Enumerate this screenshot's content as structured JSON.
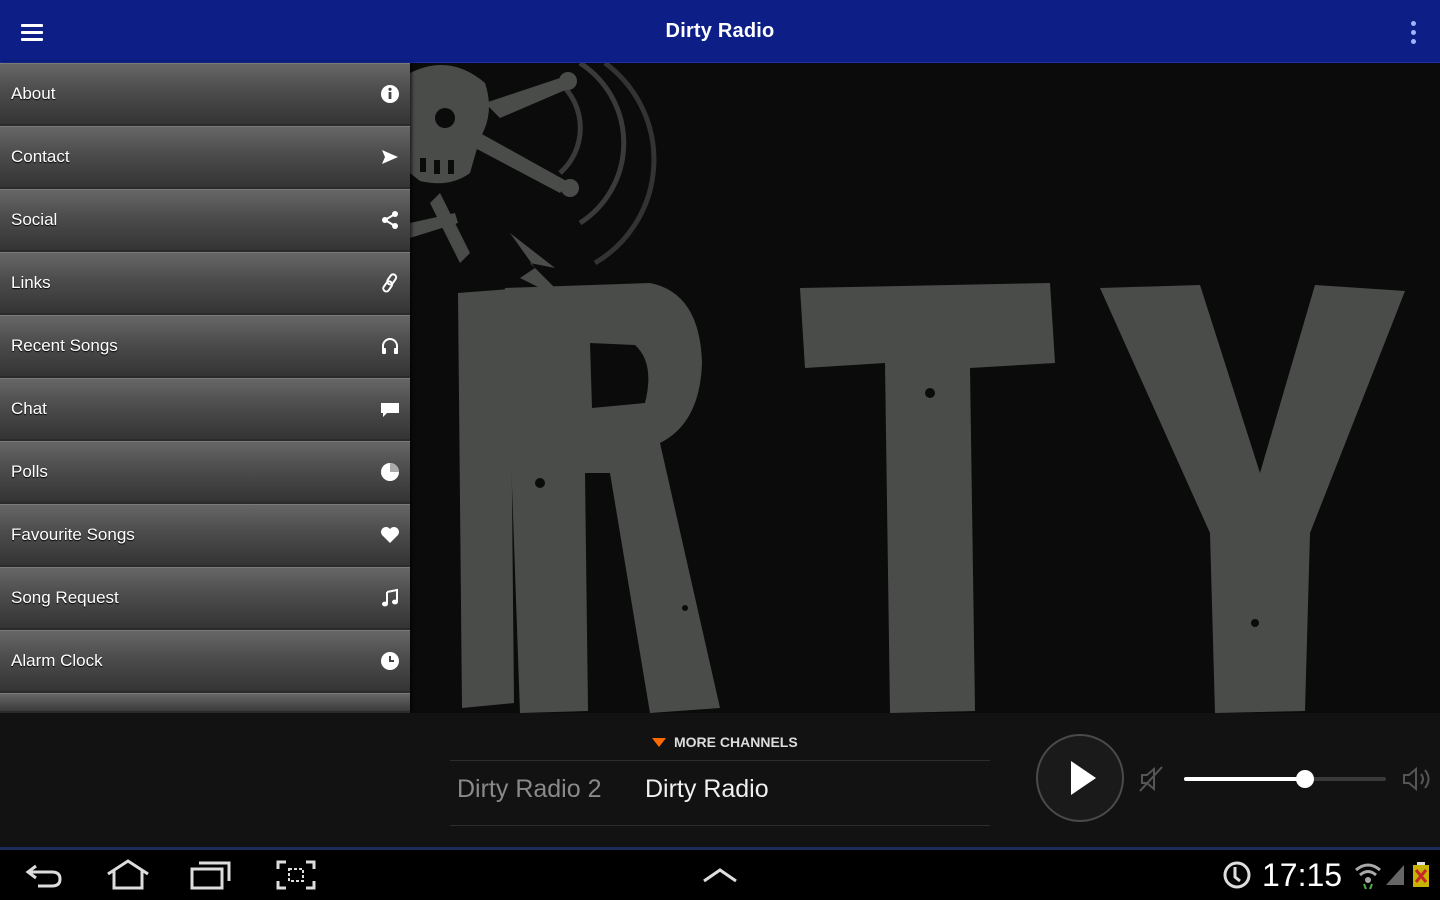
{
  "header": {
    "title": "Dirty Radio",
    "menu_icon": "hamburger-icon",
    "overflow_icon": "overflow-menu-icon"
  },
  "sidebar": {
    "items": [
      {
        "label": "About",
        "icon": "info-icon"
      },
      {
        "label": "Contact",
        "icon": "send-icon"
      },
      {
        "label": "Social",
        "icon": "share-icon"
      },
      {
        "label": "Links",
        "icon": "link-icon"
      },
      {
        "label": "Recent Songs",
        "icon": "headphones-icon"
      },
      {
        "label": "Chat",
        "icon": "chat-icon"
      },
      {
        "label": "Polls",
        "icon": "pie-chart-icon"
      },
      {
        "label": "Favourite Songs",
        "icon": "heart-icon"
      },
      {
        "label": "Song Request",
        "icon": "music-note-icon"
      },
      {
        "label": "Alarm Clock",
        "icon": "clock-icon"
      }
    ]
  },
  "artwork": {
    "logo_text": "IRTY"
  },
  "player": {
    "more_channels_label": "MORE CHANNELS",
    "channels": [
      {
        "name": "Dirty Radio 2",
        "active": false
      },
      {
        "name": "Dirty Radio",
        "active": true
      }
    ],
    "volume_fraction": 0.6
  },
  "system_bar": {
    "time": "17:15"
  },
  "colors": {
    "action_bar": "#0d1f86",
    "accent": "#ff6a00",
    "artwork_text": "#4a4c4a"
  }
}
